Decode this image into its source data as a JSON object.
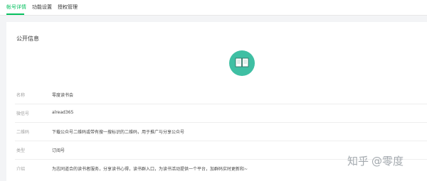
{
  "tabs": [
    {
      "label": "帐号详情",
      "active": true
    },
    {
      "label": "功能设置",
      "active": false
    },
    {
      "label": "授权管理",
      "active": false
    }
  ],
  "accent_color": "#07c160",
  "avatar_color": "#3fbfa3",
  "public_info": {
    "title": "公开信息",
    "avatar_icon": "open-book-icon",
    "rows": [
      {
        "label": "名称",
        "value": "零度读书会"
      },
      {
        "label": "微信号",
        "value": "alread365"
      },
      {
        "label": "二维码",
        "value": "下载公众号二维码或带有搜一搜标识的二维码，用于推广与分享公众号"
      },
      {
        "label": "类型",
        "value": "订阅号"
      },
      {
        "label": "介绍",
        "value": "为志同道合的读书者服务，分享读书心得，读书群入口，为读书活动提供一个平台，加群码实时更新和~"
      }
    ]
  },
  "watermark": {
    "brand": "知乎",
    "handle": "@零度"
  }
}
